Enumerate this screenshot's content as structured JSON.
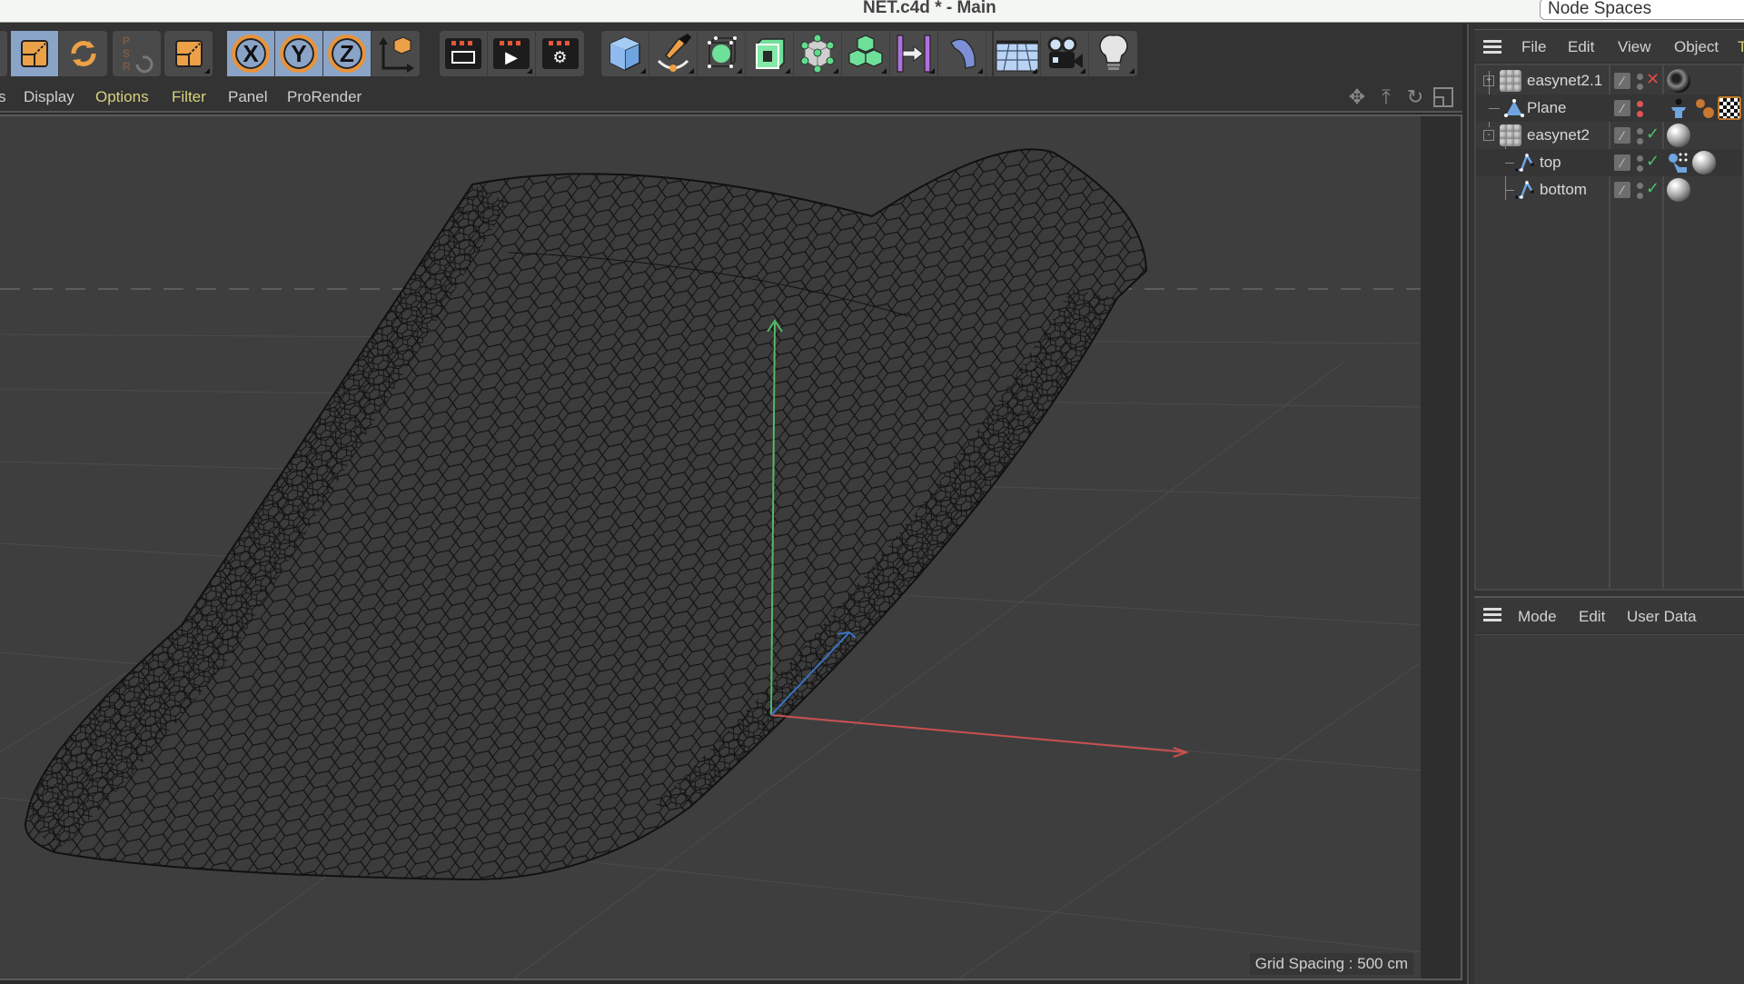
{
  "window": {
    "title": "NET.c4d * - Main",
    "node_spaces_label": "Node Spaces"
  },
  "toolbar": {
    "groups": [
      {
        "name": "transform",
        "buttons": [
          {
            "icon": "scale-icon",
            "active": true
          },
          {
            "icon": "rotate-icon",
            "active": false
          }
        ]
      },
      {
        "name": "psr",
        "buttons": [
          {
            "icon": "psr-reset-icon",
            "active": false,
            "label": "PSR"
          }
        ]
      },
      {
        "name": "scale-tool",
        "buttons": [
          {
            "icon": "scale-tool-icon",
            "active": false
          }
        ]
      },
      {
        "name": "axis-lock",
        "buttons": [
          {
            "icon": "x-axis-icon",
            "label": "X",
            "active": true
          },
          {
            "icon": "y-axis-icon",
            "label": "Y",
            "active": true
          },
          {
            "icon": "z-axis-icon",
            "label": "Z",
            "active": true
          },
          {
            "icon": "coordinate-system-icon",
            "active": false
          }
        ]
      },
      {
        "name": "render",
        "buttons": [
          {
            "icon": "render-view-icon"
          },
          {
            "icon": "render-to-picture-viewer-icon"
          },
          {
            "icon": "render-settings-icon"
          }
        ]
      },
      {
        "name": "create",
        "buttons": [
          {
            "icon": "cube-icon"
          },
          {
            "icon": "pen-spline-icon"
          },
          {
            "icon": "subdivision-surface-icon"
          },
          {
            "icon": "extrude-icon"
          },
          {
            "icon": "cloner-icon"
          },
          {
            "icon": "mograph-cubes-icon"
          },
          {
            "icon": "deformer-icon"
          },
          {
            "icon": "bend-icon"
          },
          {
            "icon": "floor-icon"
          },
          {
            "icon": "camera-icon"
          },
          {
            "icon": "light-icon"
          }
        ]
      }
    ]
  },
  "viewport_menu": {
    "items": [
      {
        "label": "s",
        "highlight": false
      },
      {
        "label": "Display",
        "highlight": false
      },
      {
        "label": "Options",
        "highlight": true
      },
      {
        "label": "Filter",
        "highlight": true
      },
      {
        "label": "Panel",
        "highlight": false
      },
      {
        "label": "ProRender",
        "highlight": false
      }
    ],
    "nav_icons": [
      "move-view-icon",
      "dolly-view-icon",
      "rotate-view-icon",
      "toggle-layout-icon"
    ]
  },
  "viewport": {
    "grid_spacing_label": "Grid Spacing : 500 cm",
    "axis_colors": {
      "x": "#c95050",
      "y": "#55b86a",
      "z": "#3a73c6"
    }
  },
  "object_manager": {
    "menu": [
      {
        "label": "File",
        "highlight": false
      },
      {
        "label": "Edit",
        "highlight": false
      },
      {
        "label": "View",
        "highlight": false
      },
      {
        "label": "Object",
        "highlight": false
      },
      {
        "label": "Ta",
        "highlight": true
      }
    ],
    "objects": [
      {
        "name": "easynet2.1",
        "icon": "polygon-object-icon",
        "expander": "+",
        "level": 0,
        "visibility": "gray",
        "status": "cross",
        "tags": [
          "material-dark-tag-icon"
        ]
      },
      {
        "name": "Plane",
        "icon": "plane-object-icon",
        "expander": "",
        "level": 0,
        "visibility": "red",
        "status": "",
        "tags": [
          "display-tag-icon",
          "mograph-tag-icon",
          "texture-tag-icon"
        ]
      },
      {
        "name": "easynet2",
        "icon": "polygon-object-icon",
        "expander": "-",
        "level": 0,
        "visibility": "gray",
        "status": "check",
        "tags": [
          "material-tag-icon"
        ]
      },
      {
        "name": "top",
        "icon": "spline-object-icon",
        "expander": "",
        "level": 1,
        "visibility": "gray",
        "status": "check",
        "tags": [
          "selection-tag-icon",
          "material-tag-icon"
        ]
      },
      {
        "name": "bottom",
        "icon": "spline-object-icon",
        "expander": "",
        "level": 1,
        "visibility": "gray",
        "status": "check",
        "tags": [
          "material-tag-icon"
        ]
      }
    ]
  },
  "attribute_manager": {
    "menu": [
      {
        "label": "Mode"
      },
      {
        "label": "Edit"
      },
      {
        "label": "User Data"
      }
    ]
  }
}
